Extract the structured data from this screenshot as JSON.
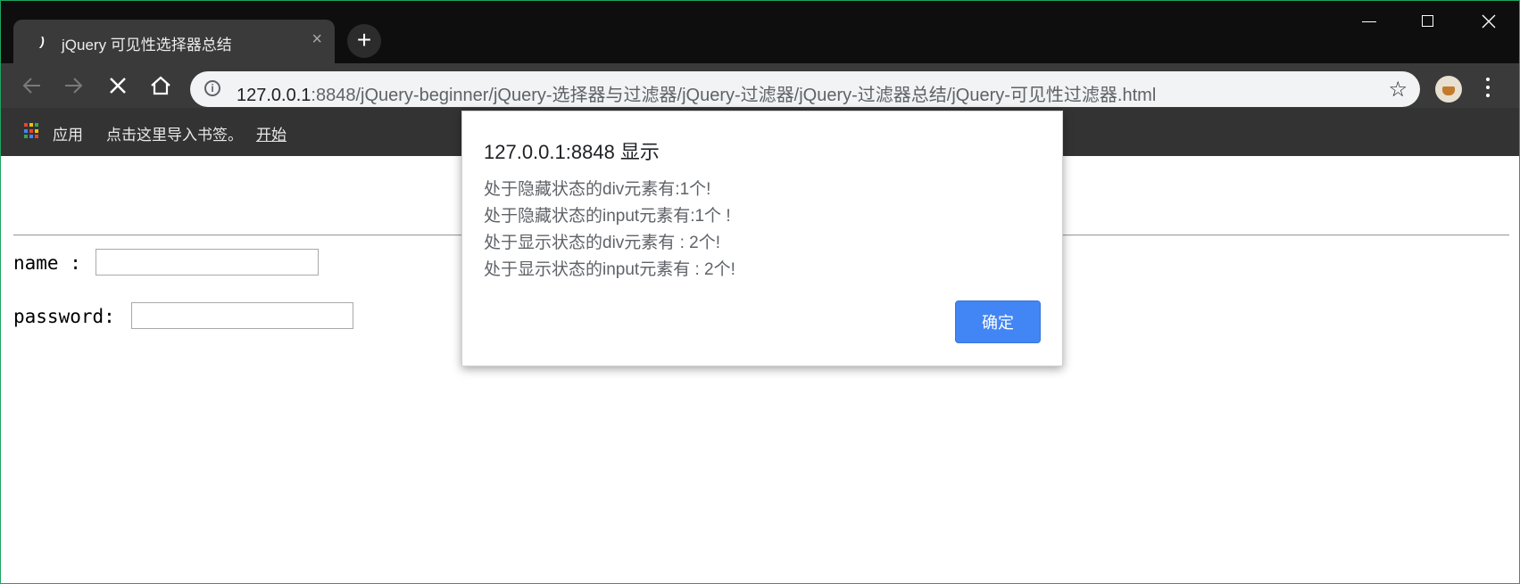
{
  "window": {
    "tab_title": "jQuery 可见性选择器总结",
    "new_tab_label": "+",
    "controls": [
      "minimize",
      "maximize",
      "close"
    ]
  },
  "toolbar": {
    "url_host": "127.0.0.1",
    "url_rest": ":8848/jQuery-beginner/jQuery-选择器与过滤器/jQuery-过滤器/jQuery-过滤器总结/jQuery-可见性过滤器.html"
  },
  "bookmarks": {
    "apps_label": "应用",
    "import_text": "点击这里导入书签。",
    "start_link": "开始"
  },
  "page": {
    "name_label": "name :",
    "password_label": "password:",
    "name_value": "",
    "password_value": ""
  },
  "dialog": {
    "title": "127.0.0.1:8848 显示",
    "lines": [
      "处于隐藏状态的div元素有:1个!",
      "处于隐藏状态的input元素有:1个 !",
      "处于显示状态的div元素有 : 2个!",
      "处于显示状态的input元素有 : 2个!"
    ],
    "ok_label": "确定"
  },
  "colors": {
    "dialog_button": "#4285f4",
    "titlebar": "#0e0e0e",
    "toolbar": "#3a3a3a"
  }
}
